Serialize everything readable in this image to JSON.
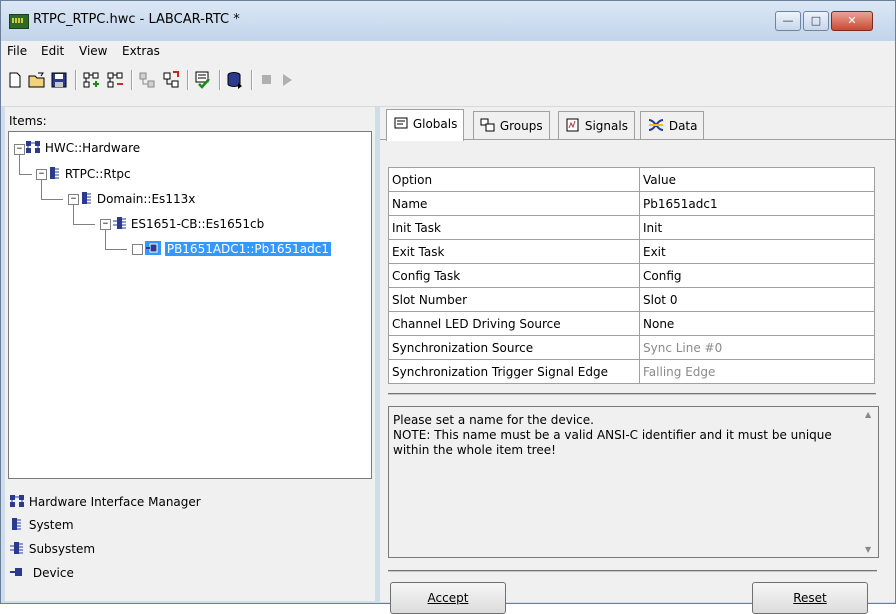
{
  "window": {
    "title": "RTPC_RTPC.hwc - LABCAR-RTC  *"
  },
  "menu": [
    "File",
    "Edit",
    "View",
    "Extras"
  ],
  "toolbar": [
    "new-icon",
    "open-icon",
    "save-icon",
    "add-group-icon",
    "remove-group-icon",
    "properties-icon",
    "export-icon",
    "check-icon",
    "database-icon",
    "stop-icon",
    "play-icon"
  ],
  "items": {
    "label": "Items:",
    "tree": [
      {
        "label": "HWC::Hardware",
        "icon": "hardware-icon"
      },
      {
        "label": "RTPC::Rtpc",
        "icon": "system-icon"
      },
      {
        "label": "Domain::Es113x",
        "icon": "system-icon"
      },
      {
        "label": "ES1651-CB::Es1651cb",
        "icon": "subsystem-icon"
      },
      {
        "label": "PB1651ADC1::Pb1651adc1",
        "icon": "device-icon"
      }
    ]
  },
  "legend": [
    {
      "label": "Hardware Interface Manager",
      "icon": "hardware-icon"
    },
    {
      "label": "System",
      "icon": "system-icon"
    },
    {
      "label": "Subsystem",
      "icon": "subsystem-icon"
    },
    {
      "label": "Device",
      "icon": "device-icon"
    }
  ],
  "tabs": [
    "Globals",
    "Groups",
    "Signals",
    "Data"
  ],
  "table": {
    "headers": [
      "Option",
      "Value"
    ],
    "rows": [
      [
        "Name",
        "Pb1651adc1"
      ],
      [
        "Init Task",
        "Init"
      ],
      [
        "Exit Task",
        "Exit"
      ],
      [
        "Config Task",
        "Config"
      ],
      [
        "Slot Number",
        "Slot 0"
      ],
      [
        "Channel LED Driving Source",
        "None"
      ],
      [
        "Synchronization Source",
        "Sync Line #0"
      ],
      [
        "Synchronization Trigger Signal Edge",
        "Falling Edge"
      ]
    ]
  },
  "description": {
    "line1": "Please set a name for the device.",
    "line2": "NOTE: This name must be a valid ANSI-C identifier and it must be unique within the whole item tree!"
  },
  "buttons": {
    "accept": "Accept",
    "reset": "Reset"
  }
}
